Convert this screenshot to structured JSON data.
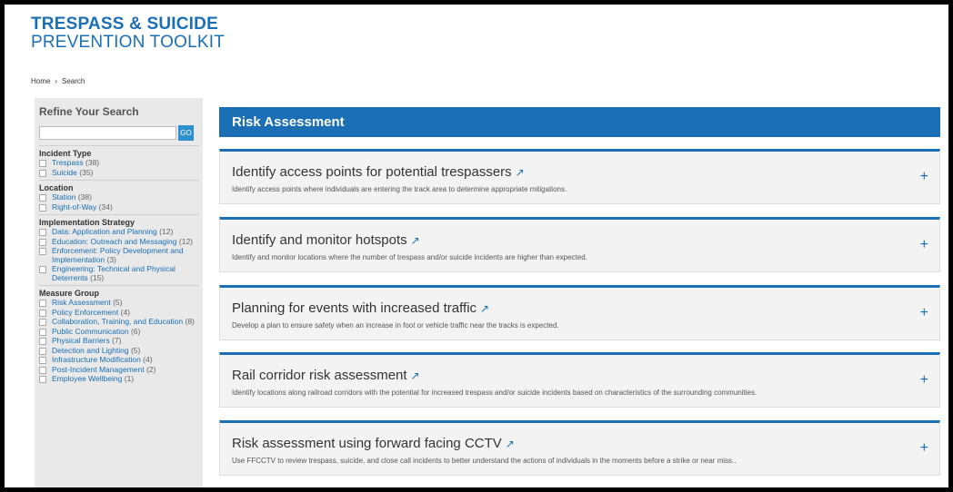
{
  "logo": {
    "line1": "TRESPASS & SUICIDE",
    "line2": "PREVENTION TOOLKIT"
  },
  "breadcrumb": {
    "home": "Home",
    "separator": "›",
    "current": "Search"
  },
  "sidebar": {
    "title": "Refine Your Search",
    "search_value": "",
    "go_label": "GO",
    "facets": [
      {
        "title": "Incident Type",
        "options": [
          {
            "label": "Trespass",
            "count": "(38)"
          },
          {
            "label": "Suicide",
            "count": "(35)"
          }
        ]
      },
      {
        "title": "Location",
        "options": [
          {
            "label": "Station",
            "count": "(38)"
          },
          {
            "label": "Right-of-Way",
            "count": "(34)"
          }
        ]
      },
      {
        "title": "Implementation Strategy",
        "options": [
          {
            "label": "Data: Application and Planning",
            "count": "(12)"
          },
          {
            "label": "Education: Outreach and Messaging",
            "count": "(12)"
          },
          {
            "label": "Enforcement: Policy Development and Implementation",
            "count": "(3)"
          },
          {
            "label": "Engineering: Technical and Physical Deterrents",
            "count": "(15)"
          }
        ]
      },
      {
        "title": "Measure Group",
        "options": [
          {
            "label": "Risk Assessment",
            "count": "(5)"
          },
          {
            "label": "Policy Enforcement",
            "count": "(4)"
          },
          {
            "label": "Collaboration, Training, and Education",
            "count": "(8)"
          },
          {
            "label": "Public Communication",
            "count": "(6)"
          },
          {
            "label": "Physical Barriers",
            "count": "(7)"
          },
          {
            "label": "Detection and Lighting",
            "count": "(5)"
          },
          {
            "label": "Infrastructure Modification",
            "count": "(4)"
          },
          {
            "label": "Post-Incident Management",
            "count": "(2)"
          },
          {
            "label": "Employee Wellbeing",
            "count": "(1)"
          }
        ]
      }
    ]
  },
  "main": {
    "header": "Risk Assessment",
    "cards": [
      {
        "title": "Identify access points for potential trespassers",
        "desc": "Identify access points where individuals are entering the track area to determine appropriate mitigations."
      },
      {
        "title": "Identify and monitor hotspots",
        "desc": "Identify and monitor locations where the number of trespass and/or suicide incidents are higher than expected."
      },
      {
        "title": "Planning for events with increased traffic",
        "desc": "Develop a plan to ensure safety when an increase in foot or vehicle traffic near the tracks is expected."
      },
      {
        "title": "Rail corridor risk assessment",
        "desc": "Identify locations along railroad corridors with the potential for increased trespass and/or suicide incidents based on characteristics of the surrounding communities."
      },
      {
        "title": "Risk assessment using forward facing CCTV",
        "desc": "Use FFCCTV to review trespass, suicide, and close call incidents to better understand the actions of individuals in the moments before a strike or near miss.."
      }
    ],
    "arrow_glyph": "↗",
    "plus_glyph": "+"
  }
}
